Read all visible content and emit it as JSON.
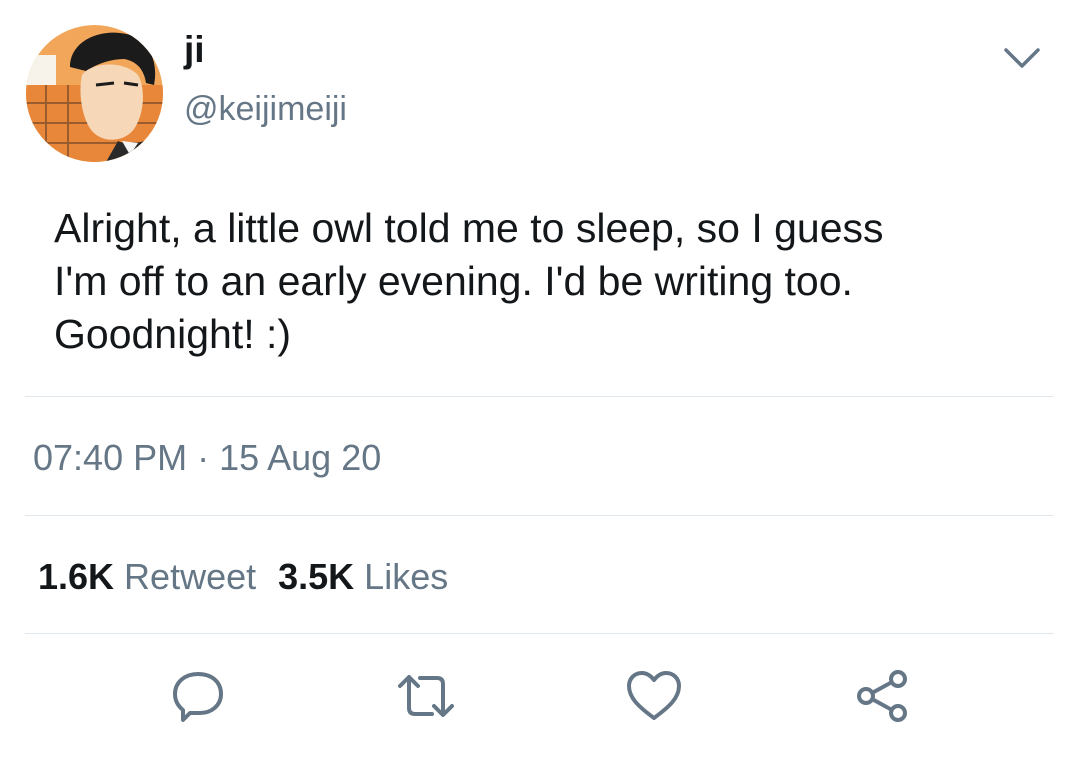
{
  "tweet": {
    "display_name": "ji",
    "handle": "@keijimeiji",
    "text": "Alright, a little owl told me to sleep, so I guess\nI'm off to an early evening. I'd be writing too.\nGoodnight! :)",
    "timestamp": "07:40 PM · 15 Aug 20"
  },
  "stats": {
    "retweet_count": "1.6K",
    "retweet_label": "Retweet",
    "likes_count": "3.5K",
    "likes_label": "Likes"
  },
  "icons": {
    "menu": "chevron-down-icon",
    "reply": "reply-icon",
    "retweet": "retweet-icon",
    "like": "heart-icon",
    "share": "share-icon"
  },
  "colors": {
    "text": "#14171a",
    "secondary": "#657786",
    "divider": "#e1e8ed",
    "icon": "#657786"
  }
}
